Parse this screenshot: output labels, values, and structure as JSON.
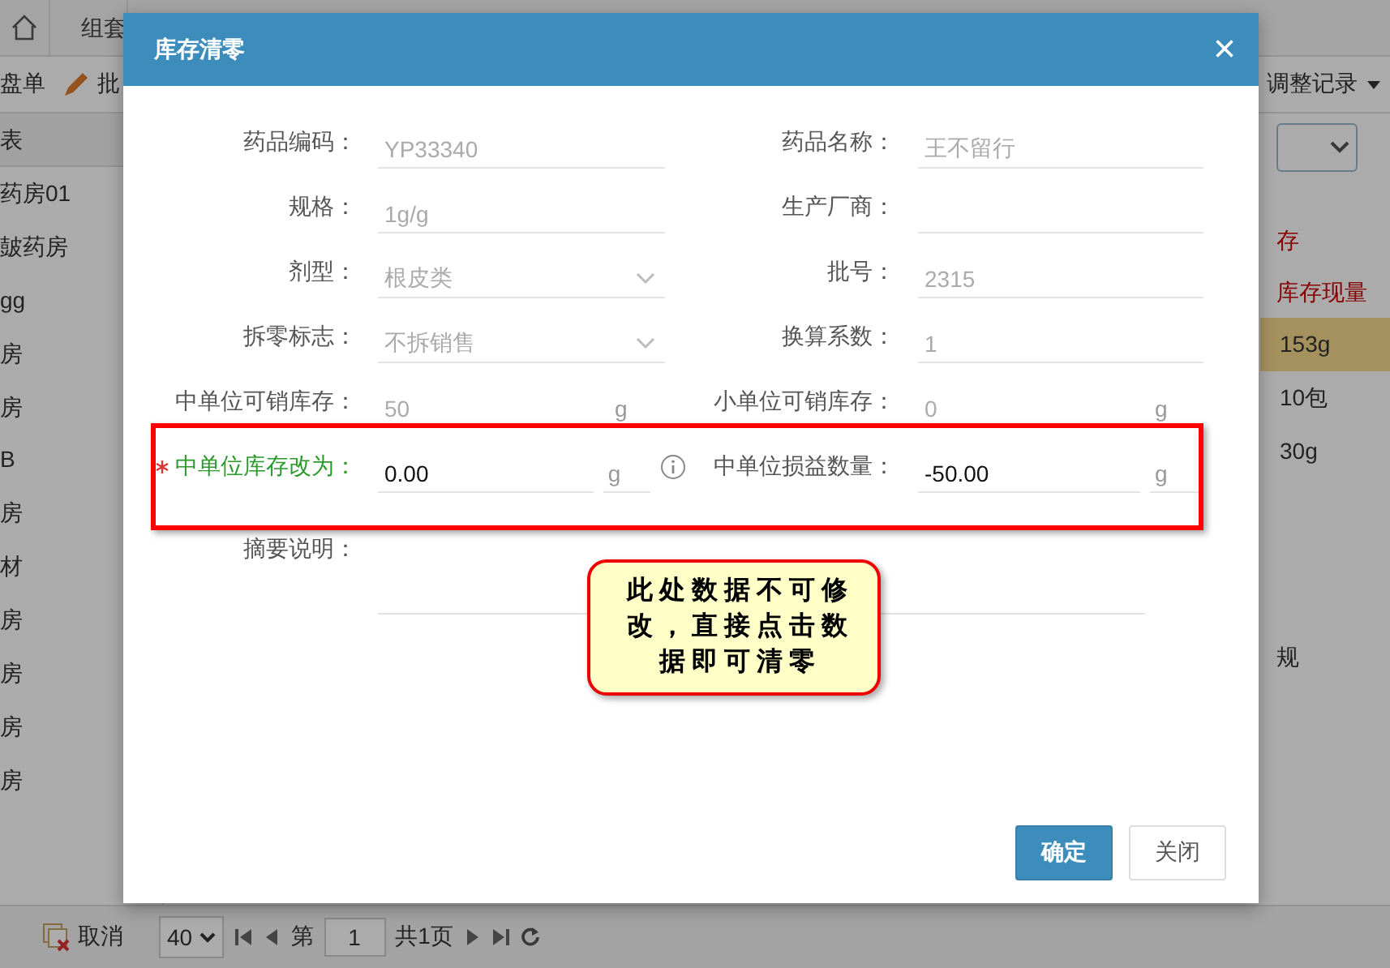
{
  "background": {
    "top_tabs": [
      {
        "label": "组套",
        "selected": false
      }
    ],
    "toolbar": [
      {
        "label": "盘单",
        "kind": "plain"
      },
      {
        "label": "批",
        "kind": "pencil"
      }
    ],
    "records_menu": "调整记录",
    "side_header": "表",
    "side_items": [
      "药房01",
      "皷药房",
      "gg",
      "房",
      "房",
      "B",
      "房",
      "材",
      "房",
      "房",
      "房",
      "房"
    ],
    "filter_label": "存",
    "stock_header": "库存现量",
    "stock_rows": [
      {
        "value": "153g",
        "selected": true
      },
      {
        "value": "10包",
        "selected": false
      },
      {
        "value": "30g",
        "selected": false
      }
    ],
    "lower_header": "规",
    "cancel_button": "取消",
    "pager": {
      "page_size": "40",
      "page_prefix": "第",
      "page": "1",
      "page_total": "共1页"
    }
  },
  "dialog": {
    "title": "库存清零",
    "close": "×",
    "fields": [
      {
        "label": "药品编码：",
        "value": "YP33340",
        "kind": "text",
        "readonly": true,
        "required": false
      },
      {
        "label": "药品名称：",
        "value": "王不留行",
        "kind": "text",
        "readonly": true,
        "required": false
      },
      {
        "label": "规格：",
        "value": "1g/g",
        "kind": "text",
        "readonly": true,
        "required": false
      },
      {
        "label": "生产厂商：",
        "kind": "text",
        "required": false
      },
      {
        "label": "剂型：",
        "value": "根皮类",
        "kind": "select",
        "readonly": true,
        "required": false
      },
      {
        "label": "批号：",
        "value": "2315",
        "kind": "text",
        "readonly": true,
        "required": false
      },
      {
        "label": "拆零标志：",
        "value": "不拆销售",
        "kind": "select",
        "readonly": true,
        "required": false
      },
      {
        "label": "换算系数：",
        "value": "1",
        "kind": "text",
        "readonly": true,
        "required": false
      },
      {
        "label": "中单位可销库存：",
        "value": "50",
        "kind": "unit",
        "unit": "g",
        "readonly": true,
        "required": false
      },
      {
        "label": "小单位可销库存：",
        "value": "0",
        "kind": "unit",
        "unit": "g",
        "readonly": true,
        "required": false
      },
      {
        "label": "中单位库存改为：",
        "value": "0.00",
        "kind": "unit",
        "unit": "g",
        "readonly": false,
        "required": true,
        "info": true
      },
      {
        "label": "中单位损益数量：",
        "value": "-50.00",
        "kind": "unit",
        "unit": "g",
        "readonly": false,
        "required": false
      },
      {
        "label": "摘要说明：",
        "kind": "textarea",
        "required": false
      }
    ],
    "callout": "此处数据不可修改，直接点击数据即可清零",
    "buttons": [
      {
        "label": "确定",
        "kind": "primary"
      },
      {
        "label": "关闭",
        "kind": "default"
      }
    ]
  }
}
